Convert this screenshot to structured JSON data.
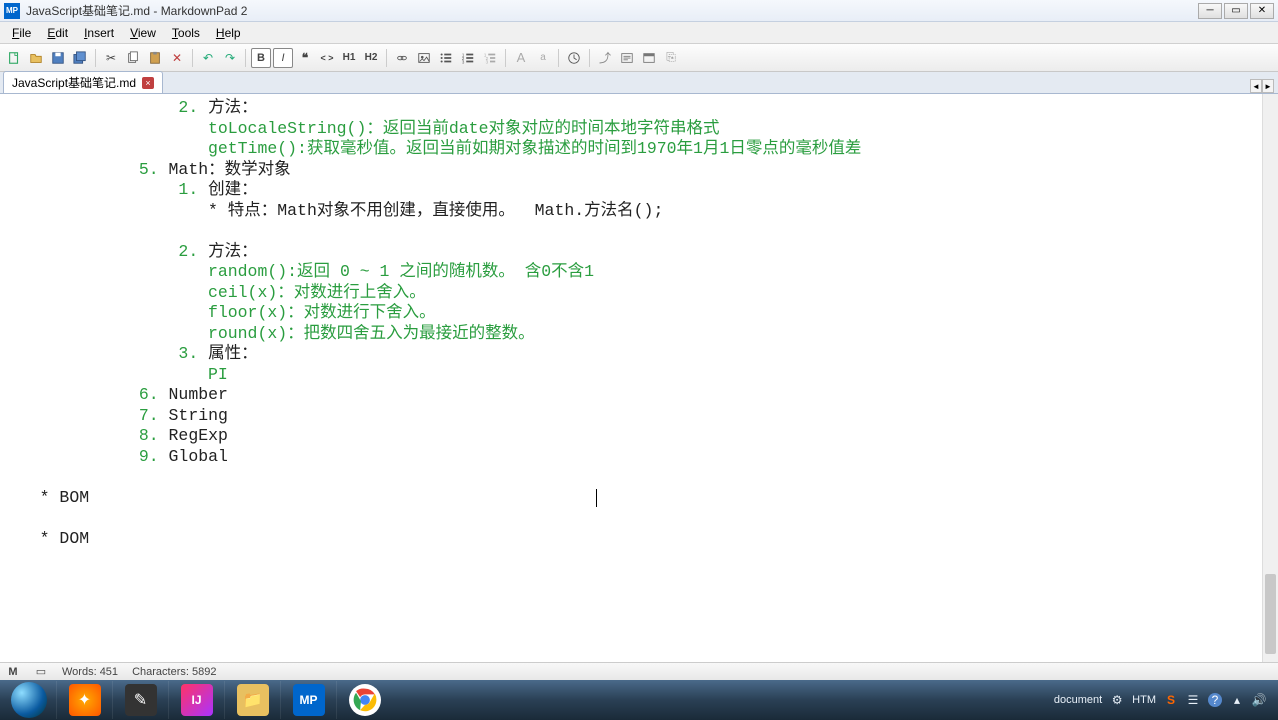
{
  "window": {
    "title": "JavaScript基础笔记.md - MarkdownPad 2",
    "app_short": "MP"
  },
  "menu": {
    "file": "File",
    "edit": "Edit",
    "insert": "Insert",
    "view": "View",
    "tools": "Tools",
    "help": "Help"
  },
  "toolbar": {
    "new": "new",
    "open": "open",
    "save": "save",
    "saveall": "save-all",
    "cut": "cut",
    "copy": "copy",
    "paste": "paste",
    "delete": "delete",
    "undo": "undo",
    "redo": "redo",
    "bold": "B",
    "italic": "I",
    "quote": "❝",
    "code": "< >",
    "h1": "H1",
    "h2": "H2",
    "link": "link",
    "image": "image",
    "ul": "ul",
    "ol": "ol",
    "hr": "hr",
    "time": "time",
    "a_lg": "A",
    "a_sm": "a",
    "refresh": "refresh",
    "external": "external",
    "preview": "preview",
    "browser": "browser",
    "export": "export"
  },
  "tab": {
    "name": "JavaScript基础笔记.md"
  },
  "content": {
    "l1_num": "2.",
    "l1_txt": " 方法：",
    "l2": "toLocaleString()：返回当前date对象对应的时间本地字符串格式",
    "l3": "getTime():获取毫秒值。返回当前如期对象描述的时间到1970年1月1日零点的毫秒值差",
    "l4_num": "5.",
    "l4_txt": " Math：数学对象",
    "l5_num": "1.",
    "l5_txt": " 创建：",
    "l6": "* 特点：Math对象不用创建，直接使用。  Math.方法名();",
    "l7_num": "2.",
    "l7_txt": " 方法：",
    "l8": "random():返回 0 ~ 1 之间的随机数。 含0不含1",
    "l9": "ceil(x)：对数进行上舍入。",
    "l10": "floor(x)：对数进行下舍入。",
    "l11": "round(x)：把数四舍五入为最接近的整数。",
    "l12_num": "3.",
    "l12_txt": " 属性：",
    "l13": "PI",
    "l14_num": "6.",
    "l14_txt": " Number",
    "l15_num": "7.",
    "l15_txt": " String",
    "l16_num": "8.",
    "l16_txt": " RegExp",
    "l17_num": "9.",
    "l17_txt": " Global",
    "l18": "* BOM",
    "l19": "* DOM"
  },
  "status": {
    "words": "Words: 451",
    "chars": "Characters: 5892"
  },
  "tray": {
    "doc": "document",
    "htm": "HTM"
  }
}
